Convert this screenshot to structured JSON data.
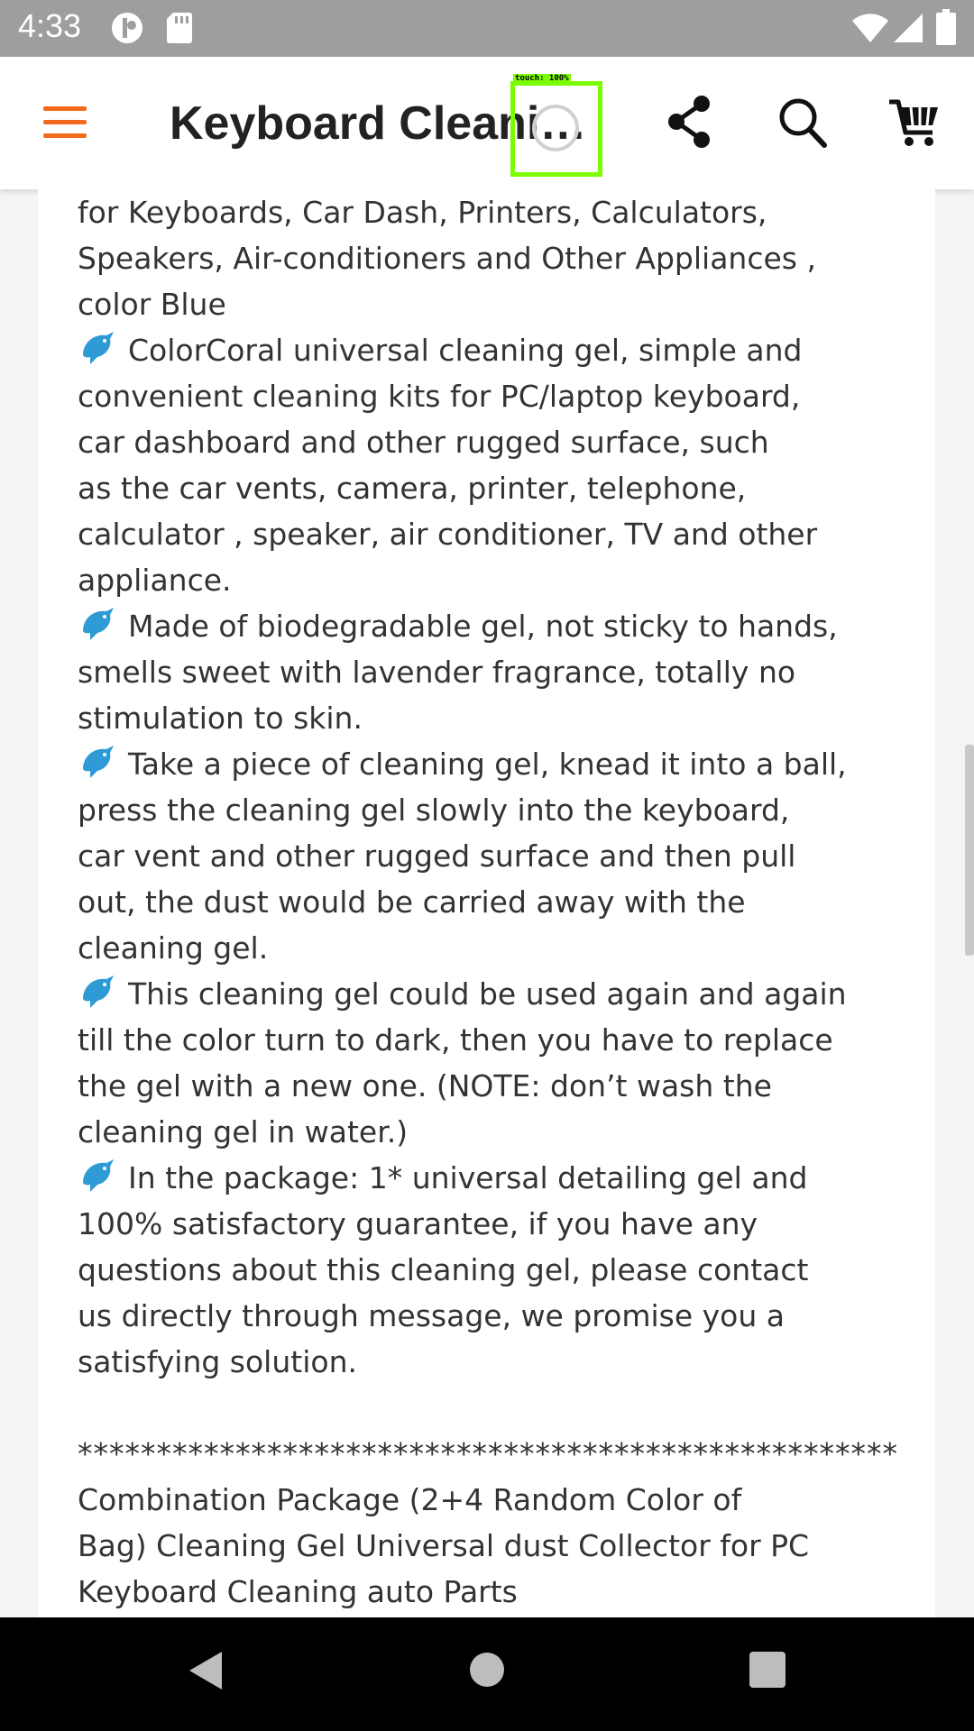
{
  "status_bar": {
    "time": "4:33",
    "icons": [
      "data-saver-icon",
      "sd-card-icon",
      "wifi-icon",
      "cellular-signal-icon",
      "battery-icon"
    ]
  },
  "app_bar": {
    "title": "Keyboard Cleaning Gel",
    "icons": [
      "menu-icon",
      "share-icon",
      "search-icon",
      "cart-icon"
    ],
    "accent_color": "#f26b1d"
  },
  "touch_indicator": {
    "label": "touch: 100%",
    "color": "#7CFC00"
  },
  "description": {
    "lines": [
      "for Keyboards, Car Dash, Printers, Calculators,",
      "Speakers, Air-conditioners and Other Appliances ,",
      "color Blue",
      "ColorCoral universal cleaning gel, simple and",
      "convenient cleaning kits for PC/laptop keyboard,",
      "car dashboard and other rugged surface, such",
      "as the car vents, camera, printer, telephone,",
      "calculator , speaker, air conditioner, TV and other",
      "appliance.",
      "Made of biodegradable gel, not sticky to hands,",
      "smells sweet with lavender fragrance, totally no",
      "stimulation to skin.",
      "Take a piece of cleaning gel, knead it into a ball,",
      "press the cleaning gel slowly into the keyboard,",
      "car vent and other rugged surface and then pull",
      "out, the dust would be carried away with the",
      "cleaning gel.",
      "This cleaning gel could be used again and again",
      "till the color turn to dark, then you have to replace",
      "the gel with a new one. (NOTE: don’t wash the",
      "cleaning gel in water.)",
      "In the package: 1* universal detailing gel and",
      "100% satisfactory guarantee, if you have any",
      "questions about this cleaning gel, please contact",
      "us directly through message, we promise you a",
      "satisfying solution.",
      "",
      "****************************************************",
      "Combination Package (2+4 Random Color of",
      "Bag) Cleaning Gel Universal dust Collector for PC",
      "Keyboard Cleaning auto Parts"
    ],
    "bullet_icon": "dolphin-icon"
  },
  "nav_bar": {
    "icons": [
      "back-icon",
      "home-icon",
      "recents-icon"
    ]
  }
}
